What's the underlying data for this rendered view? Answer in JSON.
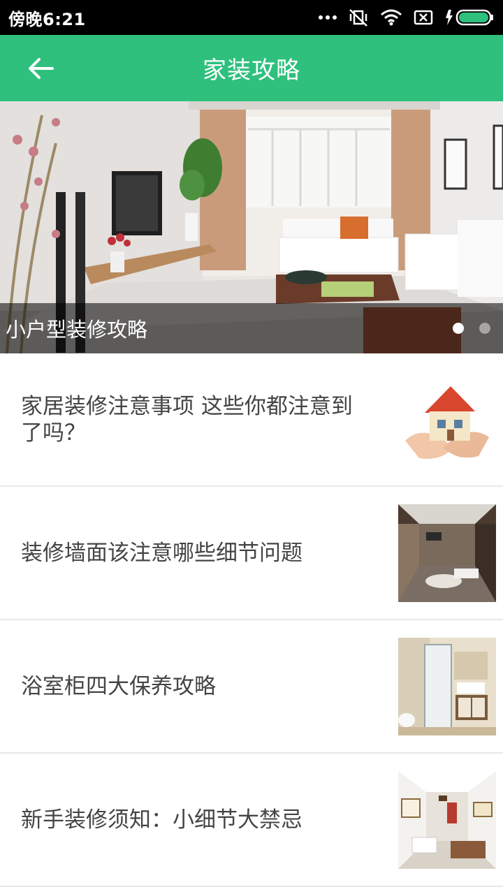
{
  "status_bar": {
    "time": "傍晚6:21"
  },
  "header": {
    "title": "家装攻略",
    "back_icon": "arrow-left-icon"
  },
  "banner": {
    "caption": "小户型装修攻略",
    "slide_count": 2,
    "active_slide": 1
  },
  "articles": [
    {
      "title": "家居装修注意事项  这些你都注意到了吗？"
    },
    {
      "title": "装修墙面该注意哪些细节问题"
    },
    {
      "title": "浴室柜四大保养攻略"
    },
    {
      "title": "新手装修须知：小细节大禁忌"
    }
  ],
  "colors": {
    "accent": "#2fc07e",
    "status_bar": "#000000",
    "text": "#444444",
    "divider": "#e8e8e8"
  }
}
